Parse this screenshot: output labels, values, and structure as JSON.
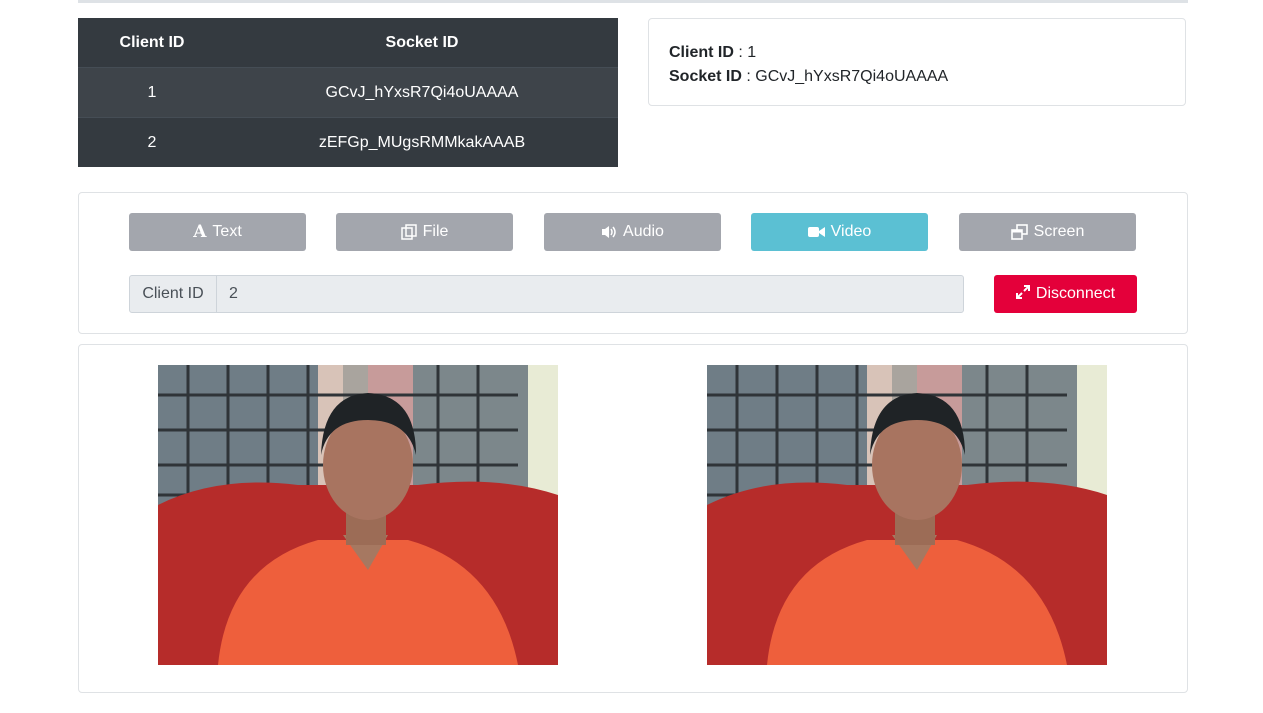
{
  "clients_table": {
    "headers": [
      "Client ID",
      "Socket ID"
    ],
    "rows": [
      {
        "client_id": "1",
        "socket_id": "GCvJ_hYxsR7Qi4oUAAAA"
      },
      {
        "client_id": "2",
        "socket_id": "zEFGp_MUgsRMMkakAAAB"
      }
    ]
  },
  "info": {
    "client_id_label": "Client ID",
    "client_id_value": " : 1",
    "socket_id_label": "Socket ID",
    "socket_id_value": " : GCvJ_hYxsR7Qi4oUAAAA"
  },
  "controls": {
    "buttons": [
      {
        "label": "Text",
        "icon": "font-icon"
      },
      {
        "label": "File",
        "icon": "copy-icon"
      },
      {
        "label": "Audio",
        "icon": "volume-icon"
      },
      {
        "label": "Video",
        "icon": "video-camera-icon"
      },
      {
        "label": "Screen",
        "icon": "window-restore-icon"
      }
    ],
    "active": "Video",
    "client_id_addon": "Client ID",
    "client_id_value": "2",
    "disconnect_label": "Disconnect",
    "disconnect_icon": "expand-icon"
  },
  "colors": {
    "table_bg": "#343a40",
    "button_gray": "#a3a6ad",
    "button_active": "#5bc0d3",
    "disconnect": "#e4003a"
  }
}
